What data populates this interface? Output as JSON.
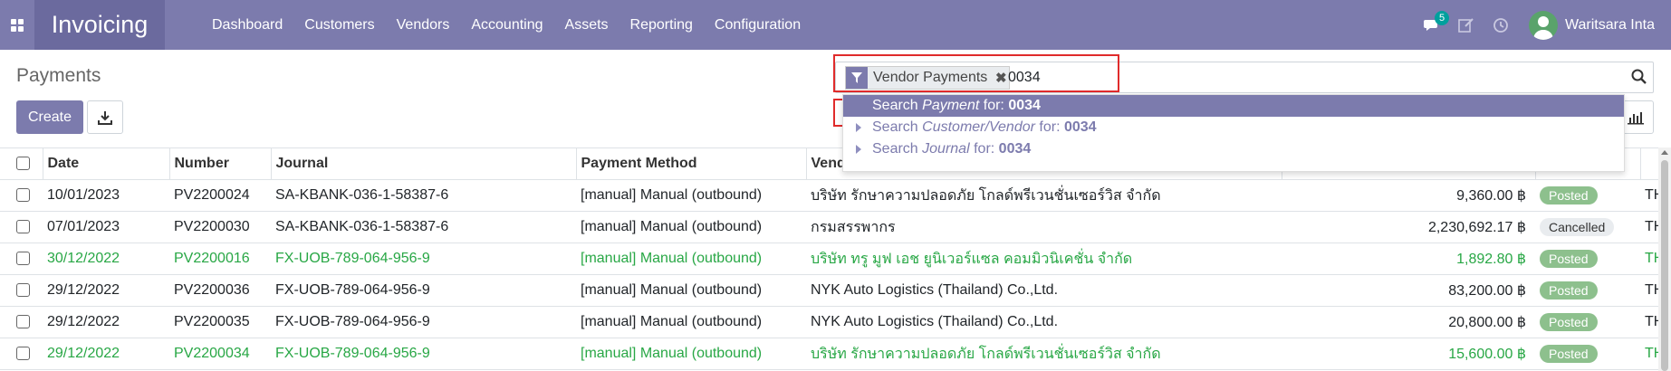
{
  "navbar": {
    "app_name": "Invoicing",
    "menu": [
      "Dashboard",
      "Customers",
      "Vendors",
      "Accounting",
      "Assets",
      "Reporting",
      "Configuration"
    ],
    "messages_count": "5",
    "user_name": "Waritsara Inta",
    "color": "#7c7bad"
  },
  "page": {
    "title": "Payments",
    "create_label": "Create"
  },
  "search": {
    "facet_label": "Vendor Payments",
    "query": "0034",
    "suggestions": [
      {
        "prefix": "Search ",
        "field": "Payment",
        "middle": " for: ",
        "value": "0034"
      },
      {
        "prefix": "Search ",
        "field": "Customer/Vendor",
        "middle": " for: ",
        "value": "0034"
      },
      {
        "prefix": "Search ",
        "field": "Journal",
        "middle": " for: ",
        "value": "0034"
      }
    ]
  },
  "table": {
    "columns": [
      "Date",
      "Number",
      "Journal",
      "Payment Method",
      "Vendor"
    ],
    "rows": [
      {
        "date": "10/01/2023",
        "number": "PV2200024",
        "journal": "SA-KBANK-036-1-58387-6",
        "method": "[manual] Manual (outbound)",
        "partner": "บริษัท รักษาความปลอดภัย โกลด์พรีเวนชั่นเซอร์วิส จำกัด",
        "amount": "9,360.00 ฿",
        "status": "Posted",
        "currency": "THB",
        "green": false
      },
      {
        "date": "07/01/2023",
        "number": "PV2200030",
        "journal": "SA-KBANK-036-1-58387-6",
        "method": "[manual] Manual (outbound)",
        "partner": "กรมสรรพากร",
        "amount": "2,230,692.17 ฿",
        "status": "Cancelled",
        "currency": "THB",
        "green": false
      },
      {
        "date": "30/12/2022",
        "number": "PV2200016",
        "journal": "FX-UOB-789-064-956-9",
        "method": "[manual] Manual (outbound)",
        "partner": "บริษัท ทรู มูฟ เอช ยูนิเวอร์แซล คอมมิวนิเคชั่น จำกัด",
        "amount": "1,892.80 ฿",
        "status": "Posted",
        "currency": "THB",
        "green": true
      },
      {
        "date": "29/12/2022",
        "number": "PV2200036",
        "journal": "FX-UOB-789-064-956-9",
        "method": "[manual] Manual (outbound)",
        "partner": "NYK Auto Logistics (Thailand) Co.,Ltd.",
        "amount": "83,200.00 ฿",
        "status": "Posted",
        "currency": "THB",
        "green": false
      },
      {
        "date": "29/12/2022",
        "number": "PV2200035",
        "journal": "FX-UOB-789-064-956-9",
        "method": "[manual] Manual (outbound)",
        "partner": "NYK Auto Logistics (Thailand) Co.,Ltd.",
        "amount": "20,800.00 ฿",
        "status": "Posted",
        "currency": "THB",
        "green": false
      },
      {
        "date": "29/12/2022",
        "number": "PV2200034",
        "journal": "FX-UOB-789-064-956-9",
        "method": "[manual] Manual (outbound)",
        "partner": "บริษัท รักษาความปลอดภัย โกลด์พรีเวนชั่นเซอร์วิส จำกัด",
        "amount": "15,600.00 ฿",
        "status": "Posted",
        "currency": "THB",
        "green": true
      }
    ]
  }
}
